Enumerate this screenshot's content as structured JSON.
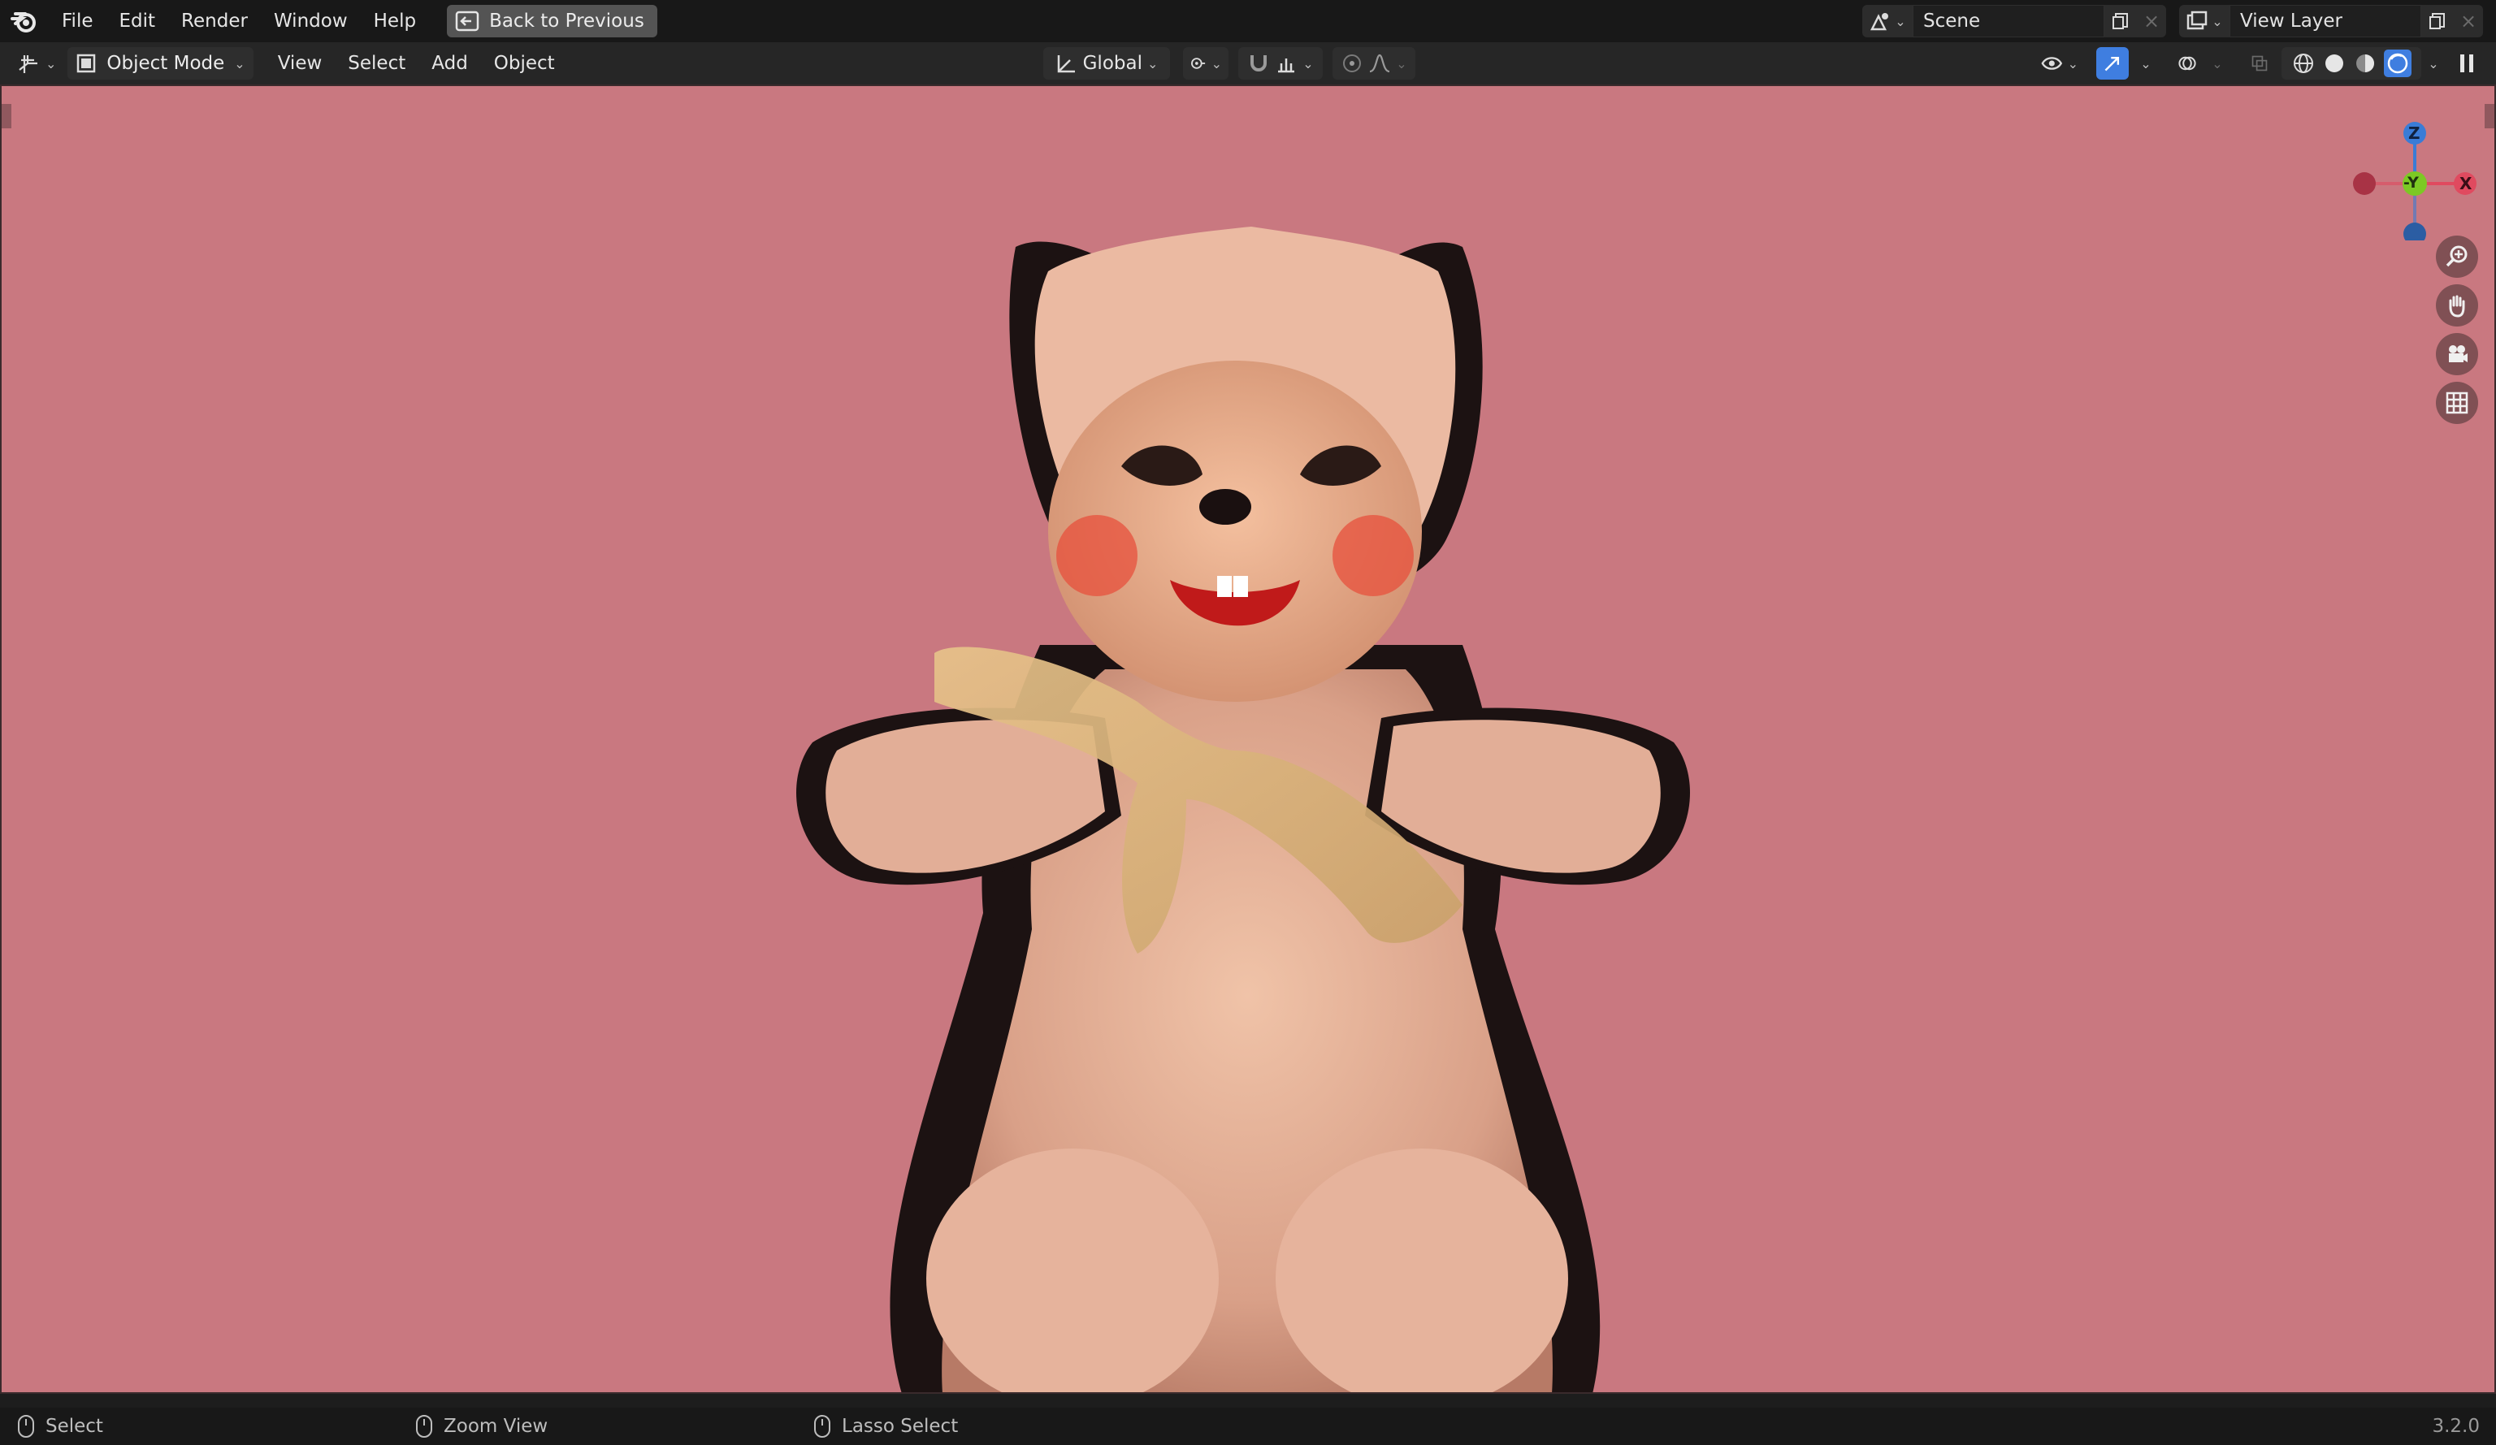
{
  "topbar": {
    "menu": [
      "File",
      "Edit",
      "Render",
      "Window",
      "Help"
    ],
    "back_button": "Back to Previous",
    "scene": "Scene",
    "view_layer": "View Layer"
  },
  "header": {
    "mode": "Object Mode",
    "menus": [
      "View",
      "Select",
      "Add",
      "Object"
    ],
    "transform_orientation": "Global"
  },
  "gizmo": {
    "z": "Z",
    "y": "-Y",
    "x": "X"
  },
  "statusbar": {
    "left_click": "Select",
    "middle_click": "Zoom View",
    "right_click": "Lasso Select",
    "version": "3.2.0"
  },
  "colors": {
    "viewport_bg": "#c97880",
    "axis_x": "#e04a5f",
    "axis_y": "#7cc924",
    "axis_z": "#3a7cd6",
    "active_blue": "#3f7ee0"
  }
}
